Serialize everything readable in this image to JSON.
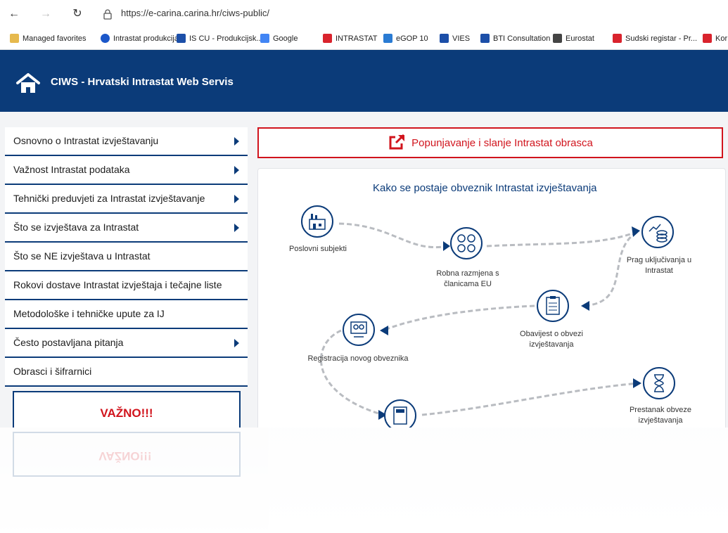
{
  "browser": {
    "url": "https://e-carina.carina.hr/ciws-public/",
    "bookmarks": [
      {
        "label": "Managed favorites",
        "icon": "folder-icon",
        "color": "#e6b94d"
      },
      {
        "label": "Intrastat produkcija",
        "icon": "globe-icon",
        "color": "#1b57c9"
      },
      {
        "label": "IS CU - Produkcijsk...",
        "icon": "flag-icon",
        "color": "#1c4fa8"
      },
      {
        "label": "Google",
        "icon": "google-icon",
        "color": "#4285f4"
      },
      {
        "label": "INTRASTAT",
        "icon": "checker-icon",
        "color": "#d9232d"
      },
      {
        "label": "eGOP 10",
        "icon": "monitor-icon",
        "color": "#2a7bd3"
      },
      {
        "label": "VIES",
        "icon": "eu-icon",
        "color": "#1c4fa8"
      },
      {
        "label": "BTI Consultation",
        "icon": "eu-icon",
        "color": "#1c4fa8"
      },
      {
        "label": "Eurostat",
        "icon": "page-icon",
        "color": "#444444"
      },
      {
        "label": "Sudski registar - Pr...",
        "icon": "flag-icon",
        "color": "#d9232d"
      },
      {
        "label": "Kor",
        "icon": "checker-icon",
        "color": "#d9232d"
      }
    ]
  },
  "header": {
    "title": "CIWS - Hrvatski Intrastat Web Servis",
    "bg": "#0b3b79"
  },
  "sidebar": {
    "items": [
      {
        "label": "Osnovno o Intrastat izvještavanju",
        "arrow": true
      },
      {
        "label": "Važnost Intrastat podataka",
        "arrow": true
      },
      {
        "label": "Tehnički preduvjeti za Intrastat izvještavanje",
        "arrow": true
      },
      {
        "label": "Što se izvještava za Intrastat",
        "arrow": true
      },
      {
        "label": "Što se NE izvještava u Intrastat",
        "arrow": false
      },
      {
        "label": "Rokovi dostave Intrastat izvještaja i tečajne liste",
        "arrow": false
      },
      {
        "label": "Metodološke i tehničke upute za IJ",
        "arrow": false
      },
      {
        "label": "Često postavljana pitanja",
        "arrow": true
      },
      {
        "label": "Obrasci i šifrarnici",
        "arrow": false
      }
    ],
    "notice": "VAŽNO!!!"
  },
  "main": {
    "cta_label": "Popunjavanje i slanje Intrastat obrasca",
    "accent": "#d1141d",
    "diagram": {
      "title": "Kako se postaje obveznik Intrastat izvještavanja",
      "nodes": [
        {
          "id": "poslovni",
          "label": "Poslovni subjekti",
          "icon": "factory-icon"
        },
        {
          "id": "robna",
          "label": "Robna razmjena s članicama EU",
          "icon": "exchange-icon"
        },
        {
          "id": "prag",
          "label": "Prag uključivanja u Intrastat",
          "icon": "coins-chart-icon"
        },
        {
          "id": "obavijest",
          "label": "Obavijest o obvezi izvještavanja",
          "icon": "clipboard-icon"
        },
        {
          "id": "registracija",
          "label": "Registracija novog obveznika",
          "icon": "registration-icon"
        },
        {
          "id": "izvjestavanje",
          "label": "",
          "icon": "calculator-icon"
        },
        {
          "id": "prestanak",
          "label": "Prestanak obveze izvještavanja",
          "icon": "hourglass-icon"
        }
      ]
    }
  }
}
